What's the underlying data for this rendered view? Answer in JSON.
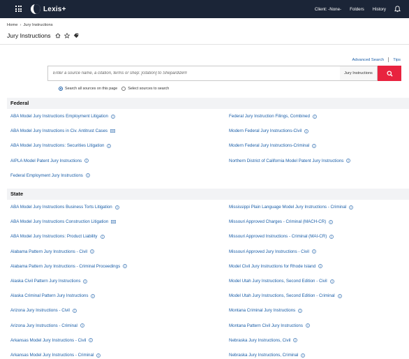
{
  "header": {
    "brand": "Lexis+",
    "nav": [
      "Client: -None-",
      "Folders",
      "History"
    ]
  },
  "breadcrumb": {
    "home": "Home",
    "current": "Jury Instructions"
  },
  "page": {
    "title": "Jury Instructions"
  },
  "search": {
    "advanced_label": "Advanced Search",
    "tips_label": "Tips",
    "placeholder": "Enter a source name, a citation, terms or shep: [citation] to Shepardize®",
    "scope": "Jury Instructions",
    "radio_all": "Search all sources on this page",
    "radio_select": "Select sources to search"
  },
  "sections": {
    "federal": {
      "heading": "Federal",
      "left": [
        "ABA Model Jury Instructions Employment Litigation",
        "ABA Model Jury Instructions in Civ. Antitrust Cases",
        "ABA Model Jury Instructions: Securities Litigation",
        "AIPLA Model Patent Jury Instructions",
        "Federal Employment Jury Instructions"
      ],
      "right": [
        "Federal Jury Instruction Filings, Combined",
        "Modern Federal Jury Instructions-Civil",
        "Modern Federal Jury Instructions-Criminal",
        "Northern District of California Model Patent Jury Instructions"
      ]
    },
    "state": {
      "heading": "State",
      "left": [
        "ABA Model Jury Instructions Business Torts Litigation",
        "ABA Model Jury Instructions Construction Litigation",
        "ABA Model Jury Instructions: Product Liability",
        "Alabama Pattern Jury Instructions - Civil",
        "Alabama Pattern Jury Instructions - Criminal Proceedings",
        "Alaska Civil Pattern Jury Instructions",
        "Alaska Criminal Pattern Jury Instructions",
        "Arizona Jury Instructions - Civil",
        "Arizona Jury Instructions - Criminal",
        "Arkansas Model Jury Instructions - Civil",
        "Arkansas Model Jury Instructions - Criminal"
      ],
      "right": [
        "Mississippi Plain Language Model Jury Instructions - Criminal",
        "Missouri Approved Charges - Criminal (MACH-CR)",
        "Missouri Approved Instructions - Criminal (MAI-CR)",
        "Missouri Approved Jury Instructions - Civil",
        "Model Civil Jury Instructions for Rhode Island",
        "Model Utah Jury Instructions, Second Edition - Civil",
        "Model Utah Jury Instructions, Second Edition - Criminal",
        "Montana Criminal Jury Instructions",
        "Montana Pattern Civil Jury Instructions",
        "Nebraska Jury Instructions, Civil",
        "Nebraska Jury Instructions, Criminal"
      ]
    }
  },
  "colors": {
    "topbar": "#1b2537",
    "link": "#1a5ea8",
    "search_button": "#e8233f"
  }
}
